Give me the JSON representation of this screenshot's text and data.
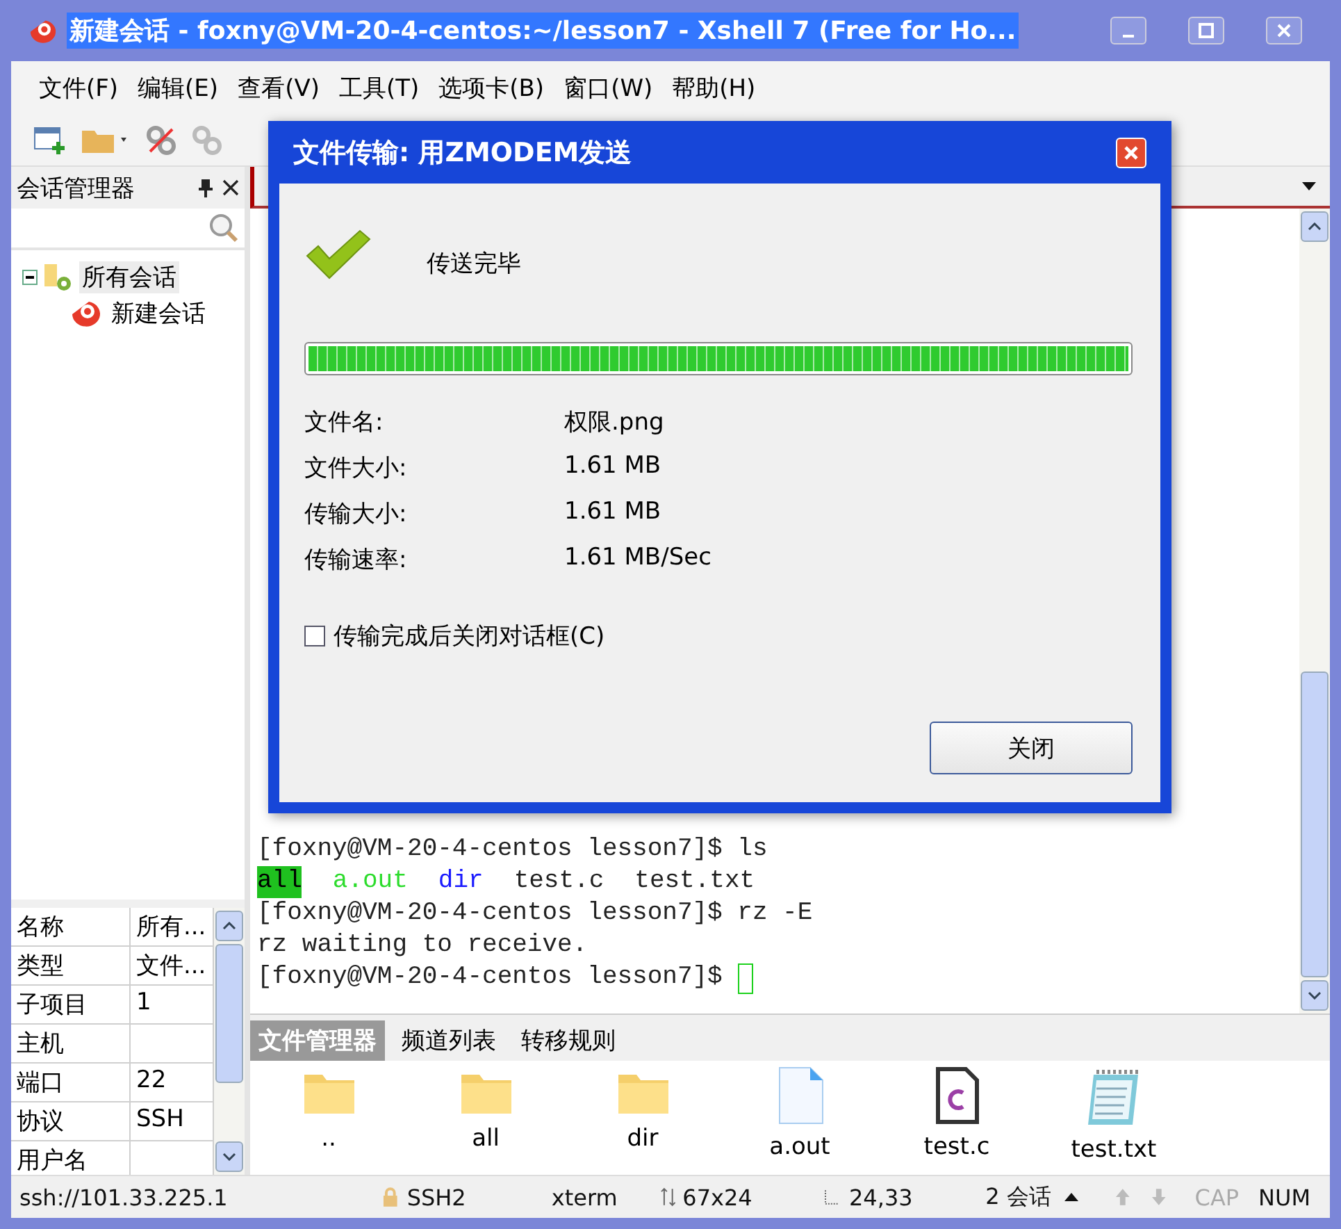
{
  "window": {
    "title": "新建会话 - foxny@VM-20-4-centos:~/lesson7 - Xshell 7 (Free for Ho..."
  },
  "menu": [
    "文件(F)",
    "编辑(E)",
    "查看(V)",
    "工具(T)",
    "选项卡(B)",
    "窗口(W)",
    "帮助(H)"
  ],
  "session_manager": {
    "title": "会话管理器",
    "tree": [
      {
        "label": "所有会话",
        "selected": true,
        "expanded": true,
        "children": [
          {
            "label": "新建会话",
            "selected": false
          }
        ]
      }
    ]
  },
  "properties": [
    {
      "name": "名称",
      "value": "所有..."
    },
    {
      "name": "类型",
      "value": "文件..."
    },
    {
      "name": "子项目",
      "value": "1"
    },
    {
      "name": "主机"
    },
    {
      "name": "端口",
      "value": "22"
    },
    {
      "name": "协议",
      "value": "SSH"
    },
    {
      "name": "用户名"
    }
  ],
  "terminal": {
    "lines": [
      [
        {
          "kind": "plain",
          "text": "[foxny@VM-20-4-centos lesson7]$ ls"
        }
      ],
      [
        {
          "kind": "exec-dir",
          "text": "all"
        },
        {
          "kind": "exec",
          "text": "a.out"
        },
        {
          "kind": "dir",
          "text": "dir"
        },
        {
          "kind": "plain",
          "text": "test.c"
        },
        {
          "kind": "plain",
          "text": "test.txt"
        }
      ],
      [
        {
          "kind": "plain",
          "text": "[foxny@VM-20-4-centos lesson7]$ rz -E"
        }
      ],
      [
        {
          "kind": "plain",
          "text": "rz waiting to receive."
        }
      ],
      [
        {
          "kind": "plain",
          "text": "[foxny@VM-20-4-centos lesson7]$"
        }
      ]
    ],
    "cursor": true
  },
  "dialog": {
    "title": "文件传输: 用ZMODEM发送",
    "status": "传送完毕",
    "progress": {
      "level": 1
    },
    "fields": [
      {
        "label": "文件名:",
        "value": "权限.png"
      },
      {
        "label": "文件大小:",
        "value": "1.61 MB"
      },
      {
        "label": "传输大小:",
        "value": "1.61 MB"
      },
      {
        "label": "传输速率:",
        "value": "1.61 MB/Sec"
      }
    ],
    "checkbox": {
      "label": "传输完成后关闭对话框(C)",
      "checked": false
    },
    "button": "关闭"
  },
  "file_manager": {
    "tabs": [
      {
        "label": "文件管理器",
        "selected": true
      },
      {
        "label": "频道列表",
        "selected": false
      },
      {
        "label": "转移规则",
        "selected": false
      }
    ],
    "files": [
      {
        "name": "..",
        "kind": "folder"
      },
      {
        "name": "all",
        "kind": "folder"
      },
      {
        "name": "dir",
        "kind": "folder"
      },
      {
        "name": "a.out",
        "kind": "file"
      },
      {
        "name": "test.c",
        "kind": "c"
      },
      {
        "name": "test.txt",
        "kind": "text"
      }
    ]
  },
  "status_bar": {
    "address": "ssh://101.33.225.1",
    "protocol": "SSH2",
    "terminal": "xterm",
    "size": "67x24",
    "cursor": "24,33",
    "sessions": "2 会话",
    "keys": [
      {
        "label": "CAP",
        "on": false
      },
      {
        "label": "NUM",
        "on": true
      }
    ]
  }
}
